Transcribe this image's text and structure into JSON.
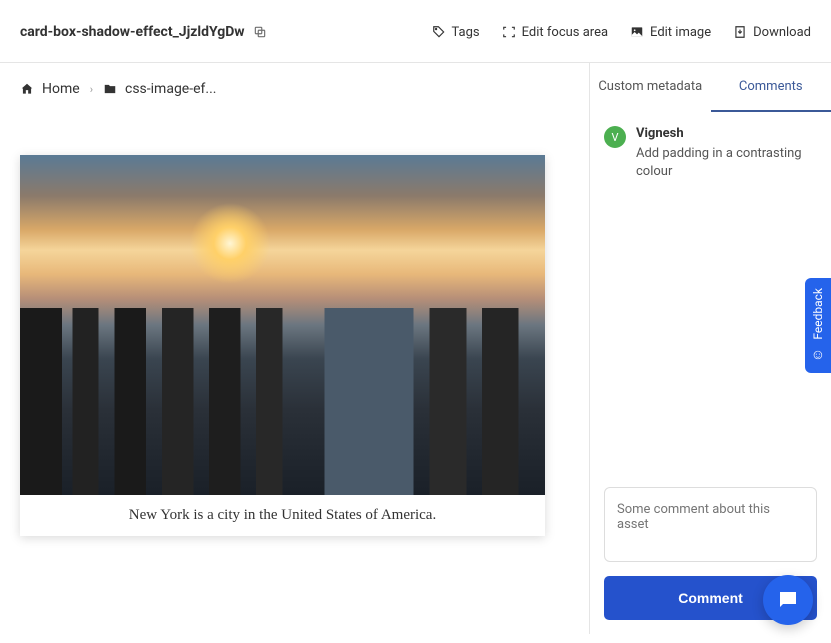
{
  "header": {
    "title": "card-box-shadow-effect_JjzldYgDw",
    "actions": {
      "tags": "Tags",
      "editFocus": "Edit focus area",
      "editImage": "Edit image",
      "download": "Download"
    }
  },
  "breadcrumb": {
    "home": "Home",
    "folder": "css-image-ef..."
  },
  "card": {
    "caption": "New York is a city in the United States of America."
  },
  "sidebar": {
    "tabs": {
      "metadata": "Custom metadata",
      "comments": "Comments"
    },
    "comments": [
      {
        "avatarLetter": "V",
        "author": "Vignesh",
        "text": "Add padding in a contrasting colour"
      }
    ],
    "inputPlaceholder": "Some comment about this asset",
    "submitLabel": "Comment"
  },
  "floating": {
    "feedback": "Feedback"
  }
}
